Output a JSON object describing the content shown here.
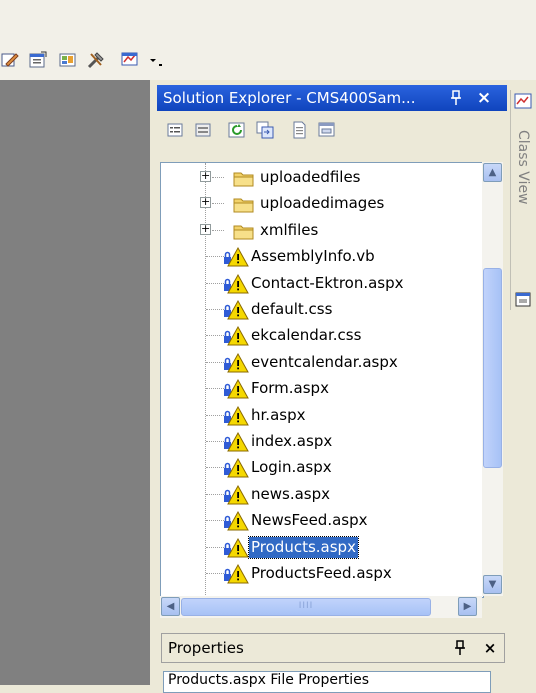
{
  "toolbar": {
    "icons": [
      "edit-icon",
      "properties-icon",
      "image-icon",
      "tools-icon",
      "diagram-icon",
      "dropdown-icon"
    ]
  },
  "solution_explorer": {
    "title": "Solution Explorer - CMS400Sam...",
    "pin_glyph": "ᵖ",
    "close_glyph": "×",
    "toolbar_icons": [
      "properties-icon",
      "show-all-files-icon",
      "refresh-icon",
      "nest-files-icon",
      "view-code-icon",
      "view-designer-icon"
    ],
    "items": [
      {
        "label": "uploadedfiles",
        "type": "folder",
        "expandable": true,
        "selected": false
      },
      {
        "label": "uploadedimages",
        "type": "folder",
        "expandable": true,
        "selected": false
      },
      {
        "label": "xmlfiles",
        "type": "folder",
        "expandable": true,
        "selected": false
      },
      {
        "label": "AssemblyInfo.vb",
        "type": "file-locked-warning",
        "expandable": false,
        "selected": false
      },
      {
        "label": "Contact-Ektron.aspx",
        "type": "file-locked-warning",
        "expandable": false,
        "selected": false
      },
      {
        "label": "default.css",
        "type": "file-locked-warning",
        "expandable": false,
        "selected": false
      },
      {
        "label": "ekcalendar.css",
        "type": "file-locked-warning",
        "expandable": false,
        "selected": false
      },
      {
        "label": "eventcalendar.aspx",
        "type": "file-locked-warning",
        "expandable": false,
        "selected": false
      },
      {
        "label": "Form.aspx",
        "type": "file-locked-warning",
        "expandable": false,
        "selected": false
      },
      {
        "label": "hr.aspx",
        "type": "file-locked-warning",
        "expandable": false,
        "selected": false
      },
      {
        "label": "index.aspx",
        "type": "file-locked-warning",
        "expandable": false,
        "selected": false
      },
      {
        "label": "Login.aspx",
        "type": "file-locked-warning",
        "expandable": false,
        "selected": false
      },
      {
        "label": "news.aspx",
        "type": "file-locked-warning",
        "expandable": false,
        "selected": false
      },
      {
        "label": "NewsFeed.aspx",
        "type": "file-locked-warning",
        "expandable": false,
        "selected": false
      },
      {
        "label": "Products.aspx",
        "type": "file-locked-warning",
        "expandable": false,
        "selected": true
      },
      {
        "label": "ProductsFeed.aspx",
        "type": "file-locked-warning",
        "expandable": false,
        "selected": false
      }
    ],
    "scroll_up": "▲",
    "scroll_down": "▼",
    "scroll_left": "◀",
    "scroll_right": "▶",
    "hthumb_grip": "IIII"
  },
  "class_view": {
    "label": "Class View"
  },
  "properties": {
    "title": "Properties",
    "pin_glyph": "ᵖ",
    "close_glyph": "×",
    "selected_object": "Products.aspx  File Properties"
  },
  "colors": {
    "title_bar": "#1f56cc",
    "selection": "#316ac5",
    "folder": "#f2d26a",
    "warning": "#f5d800",
    "lock": "#2f5bd6"
  }
}
